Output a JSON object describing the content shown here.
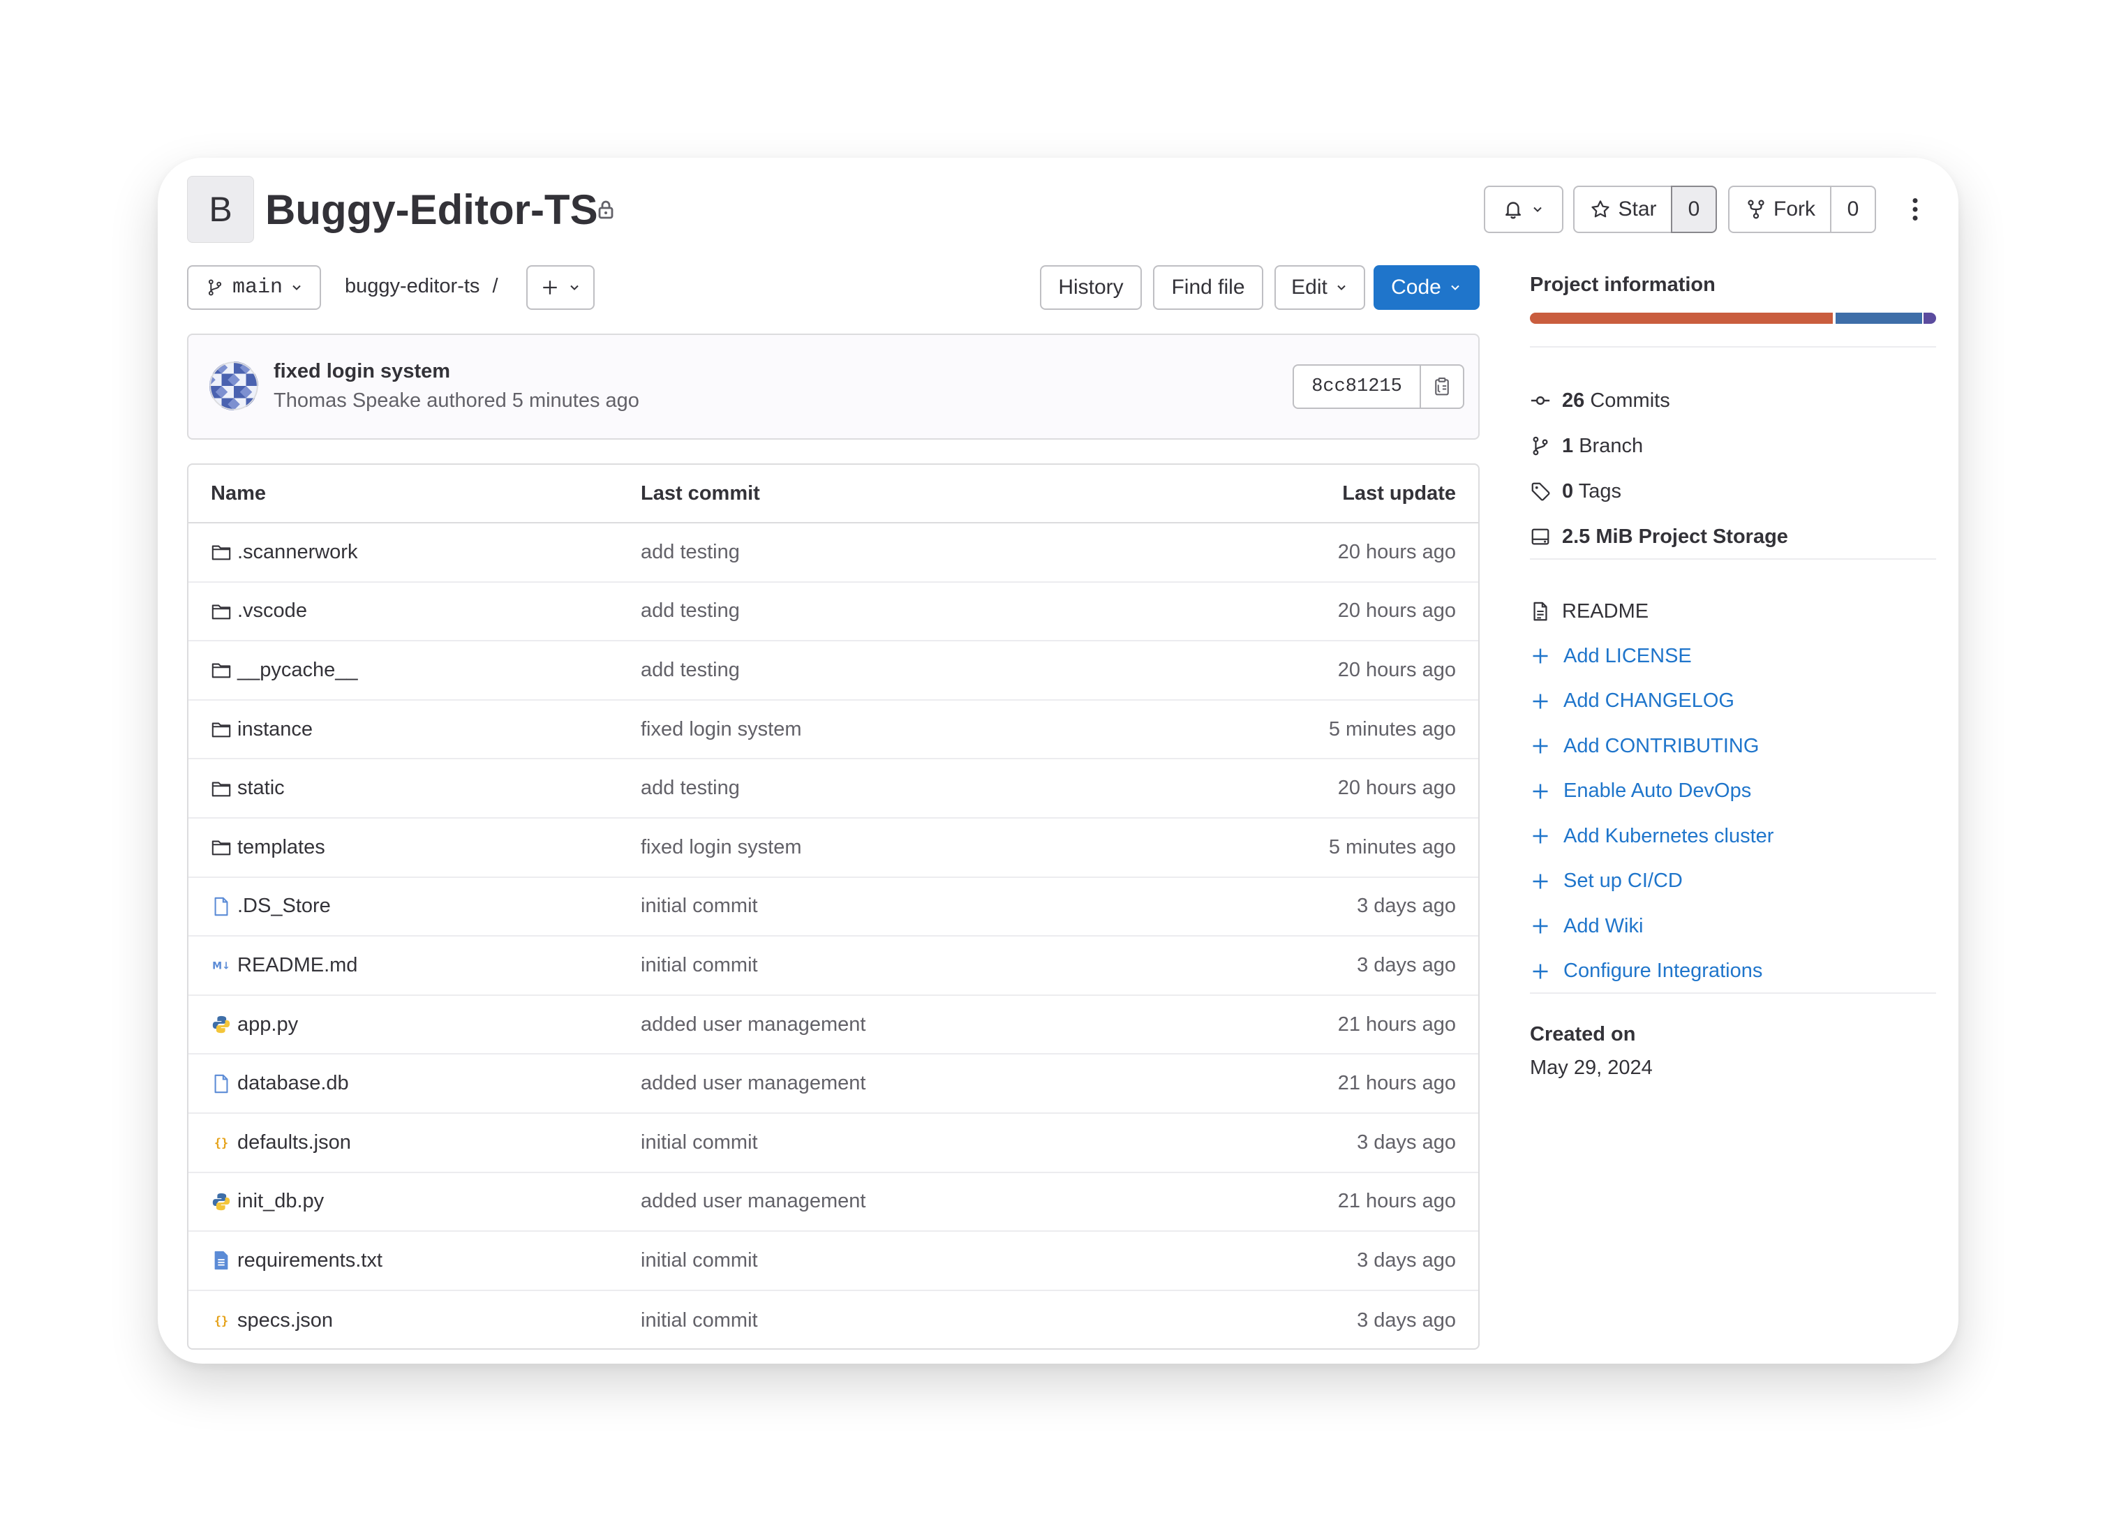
{
  "project": {
    "avatar_letter": "B",
    "name": "Buggy-Editor-TS",
    "visibility_icon": "lock-icon"
  },
  "header_actions": {
    "notifications_icon": "bell-icon",
    "star_label": "Star",
    "star_count": "0",
    "fork_label": "Fork",
    "fork_count": "0",
    "more_icon": "kebab-vertical-icon"
  },
  "toolbar": {
    "branch": "main",
    "breadcrumb_path": "buggy-editor-ts",
    "breadcrumb_separator": "/",
    "add_icon": "plus-icon",
    "history_label": "History",
    "find_file_label": "Find file",
    "edit_label": "Edit",
    "code_label": "Code"
  },
  "last_commit": {
    "message": "fixed login system",
    "author_line": "Thomas Speake authored 5 minutes ago",
    "sha": "8cc81215",
    "copy_icon": "clipboard-icon"
  },
  "table": {
    "headers": {
      "name": "Name",
      "last_commit": "Last commit",
      "last_update": "Last update"
    },
    "rows": [
      {
        "name": ".scannerwork",
        "type": "folder",
        "commit": "add testing",
        "updated": "20 hours ago"
      },
      {
        "name": ".vscode",
        "type": "folder",
        "commit": "add testing",
        "updated": "20 hours ago"
      },
      {
        "name": "__pycache__",
        "type": "folder",
        "commit": "add testing",
        "updated": "20 hours ago"
      },
      {
        "name": "instance",
        "type": "folder",
        "commit": "fixed login system",
        "updated": "5 minutes ago"
      },
      {
        "name": "static",
        "type": "folder",
        "commit": "add testing",
        "updated": "20 hours ago"
      },
      {
        "name": "templates",
        "type": "folder",
        "commit": "fixed login system",
        "updated": "5 minutes ago"
      },
      {
        "name": ".DS_Store",
        "type": "file",
        "commit": "initial commit",
        "updated": "3 days ago"
      },
      {
        "name": "README.md",
        "type": "markdown",
        "commit": "initial commit",
        "updated": "3 days ago"
      },
      {
        "name": "app.py",
        "type": "python",
        "commit": "added user management",
        "updated": "21 hours ago"
      },
      {
        "name": "database.db",
        "type": "file",
        "commit": "added user management",
        "updated": "21 hours ago"
      },
      {
        "name": "defaults.json",
        "type": "json",
        "commit": "initial commit",
        "updated": "3 days ago"
      },
      {
        "name": "init_db.py",
        "type": "python",
        "commit": "added user management",
        "updated": "21 hours ago"
      },
      {
        "name": "requirements.txt",
        "type": "text",
        "commit": "initial commit",
        "updated": "3 days ago"
      },
      {
        "name": "specs.json",
        "type": "json",
        "commit": "initial commit",
        "updated": "3 days ago"
      }
    ]
  },
  "sidebar": {
    "title": "Project information",
    "language_colors": [
      "#c95d3e",
      "#3e6ea8",
      "#5b4b9e"
    ],
    "stats": [
      {
        "icon": "commit-icon",
        "value": "26",
        "label": "Commits"
      },
      {
        "icon": "branch-icon",
        "value": "1",
        "label": "Branch"
      },
      {
        "icon": "tag-icon",
        "value": "0",
        "label": "Tags"
      },
      {
        "icon": "storage-icon",
        "value": "2.5 MiB",
        "label": "Project Storage"
      }
    ],
    "readme_label": "README",
    "links": [
      "Add LICENSE",
      "Add CHANGELOG",
      "Add CONTRIBUTING",
      "Enable Auto DevOps",
      "Add Kubernetes cluster",
      "Set up CI/CD",
      "Add Wiki",
      "Configure Integrations"
    ],
    "created_label": "Created on",
    "created_date": "May 29, 2024"
  },
  "colors": {
    "primary": "#1f75cb",
    "text": "#333238",
    "muted": "#626168",
    "border": "#dcdcde"
  }
}
